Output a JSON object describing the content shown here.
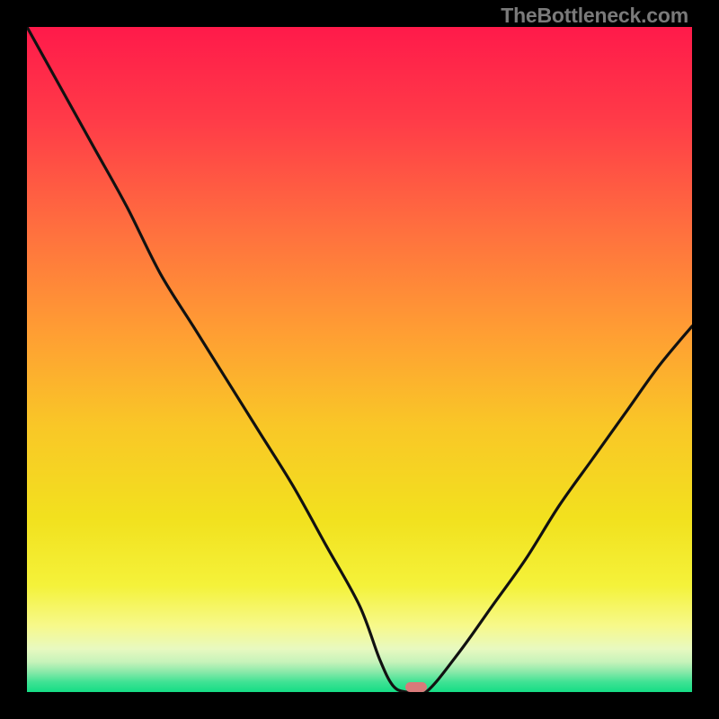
{
  "watermark": "TheBottleneck.com",
  "chart_data": {
    "type": "line",
    "title": "",
    "xlabel": "",
    "ylabel": "",
    "xlim": [
      0,
      100
    ],
    "ylim": [
      0,
      100
    ],
    "grid": false,
    "legend": false,
    "x": [
      0,
      5,
      10,
      15,
      20,
      25,
      30,
      35,
      40,
      45,
      50,
      53,
      55,
      57,
      60,
      65,
      70,
      75,
      80,
      85,
      90,
      95,
      100
    ],
    "values": [
      100,
      91,
      82,
      73,
      63,
      55,
      47,
      39,
      31,
      22,
      13,
      5,
      1,
      0,
      0,
      6,
      13,
      20,
      28,
      35,
      42,
      49,
      55
    ],
    "description": "V-shaped bottleneck curve. Value drops from ~100 on the left to a minimum of 0 near x≈57–60, then rises to ~55 on the right.",
    "minimum_marker": {
      "x": 58.5,
      "width_pct": 3.2
    },
    "background_gradient": {
      "stops": [
        {
          "offset": 0,
          "color": "#ff1a4a"
        },
        {
          "offset": 0.14,
          "color": "#ff3b48"
        },
        {
          "offset": 0.3,
          "color": "#ff6e3f"
        },
        {
          "offset": 0.46,
          "color": "#ff9e33"
        },
        {
          "offset": 0.6,
          "color": "#f9c727"
        },
        {
          "offset": 0.74,
          "color": "#f2e11e"
        },
        {
          "offset": 0.84,
          "color": "#f4f23a"
        },
        {
          "offset": 0.9,
          "color": "#f7f98a"
        },
        {
          "offset": 0.935,
          "color": "#e8f9c0"
        },
        {
          "offset": 0.955,
          "color": "#c6f3ba"
        },
        {
          "offset": 0.97,
          "color": "#88e9a9"
        },
        {
          "offset": 0.985,
          "color": "#3fe294"
        },
        {
          "offset": 1.0,
          "color": "#15dd85"
        }
      ]
    }
  }
}
